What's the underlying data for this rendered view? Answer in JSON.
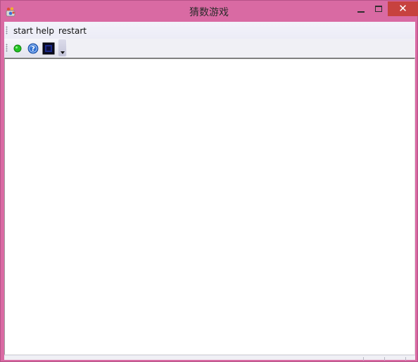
{
  "window": {
    "title": "猜数游戏",
    "close_glyph": "✕"
  },
  "menubar": {
    "items": [
      {
        "label": "start"
      },
      {
        "label": "help"
      },
      {
        "label": "restart"
      }
    ]
  },
  "toolbar": {
    "buttons": [
      {
        "icon": "green-circle-icon"
      },
      {
        "icon": "help-icon"
      },
      {
        "icon": "dark-square-icon"
      }
    ]
  },
  "colors": {
    "titlebar": "#d96aa3",
    "close_button": "#c7423f",
    "client_bg": "#f0f0f5",
    "content_bg": "#ffffff"
  }
}
